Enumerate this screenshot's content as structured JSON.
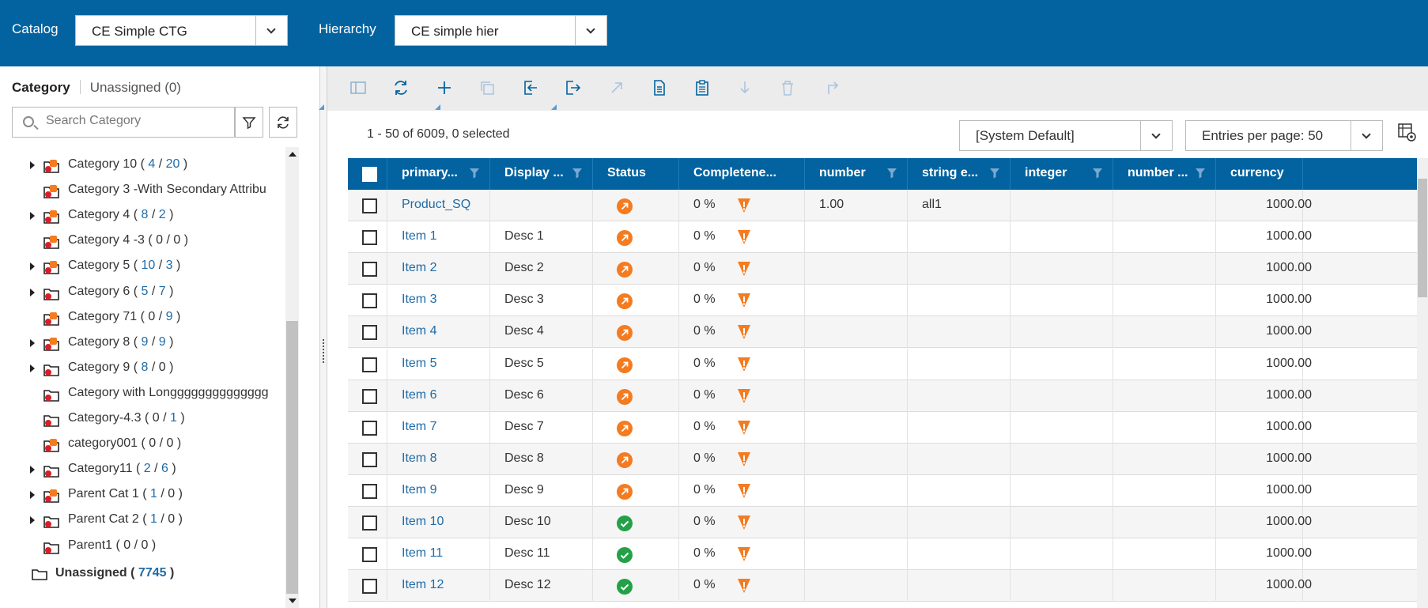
{
  "header": {
    "catalog_label": "Catalog",
    "catalog_value": "CE Simple CTG",
    "hierarchy_label": "Hierarchy",
    "hierarchy_value": "CE simple hier"
  },
  "left_panel": {
    "tab_category": "Category",
    "tab_unassigned": "Unassigned (0)",
    "search_placeholder": "Search Category",
    "tree": [
      {
        "name": "Category 10",
        "a": "4",
        "b": "20",
        "expandable": true,
        "badge": true
      },
      {
        "name": "Category 3 -With Secondary Attribu",
        "a": "",
        "b": "",
        "expandable": false,
        "badge": true
      },
      {
        "name": "Category 4",
        "a": "8",
        "b": "2",
        "expandable": true,
        "badge": true
      },
      {
        "name": "Category 4 -3",
        "a": "0",
        "b": "0",
        "expandable": false,
        "badge": true
      },
      {
        "name": "Category 5",
        "a": "10",
        "b": "3",
        "expandable": true,
        "badge": true
      },
      {
        "name": "Category 6",
        "a": "5",
        "b": "7",
        "expandable": true,
        "badge": false
      },
      {
        "name": "Category 71",
        "a": "0",
        "b": "9",
        "expandable": false,
        "badge": true
      },
      {
        "name": "Category 8",
        "a": "9",
        "b": "9",
        "expandable": true,
        "badge": true
      },
      {
        "name": "Category 9",
        "a": "8",
        "b": "0",
        "expandable": true,
        "badge": false
      },
      {
        "name": "Category with Longggggggggggggg",
        "a": "",
        "b": "",
        "expandable": false,
        "badge": false
      },
      {
        "name": "Category-4.3",
        "a": "0",
        "b": "1",
        "expandable": false,
        "badge": false
      },
      {
        "name": "category001",
        "a": "0",
        "b": "0",
        "expandable": false,
        "badge": true
      },
      {
        "name": "Category11",
        "a": "2",
        "b": "6",
        "expandable": true,
        "badge": false
      },
      {
        "name": "Parent Cat 1",
        "a": "1",
        "b": "0",
        "expandable": true,
        "badge": true
      },
      {
        "name": "Parent Cat 2",
        "a": "1",
        "b": "0",
        "expandable": true,
        "badge": false
      },
      {
        "name": "Parent1",
        "a": "0",
        "b": "0",
        "expandable": false,
        "badge": false
      }
    ],
    "unassigned_label": "Unassigned (",
    "unassigned_count": "7745",
    "unassigned_close": ")"
  },
  "main": {
    "summary": "1 - 50 of 6009, 0 selected",
    "view_select": "[System Default]",
    "entries_select": "Entries per page: 50",
    "toolbar_icons": [
      "panel-toggle-icon",
      "refresh-icon",
      "add-icon",
      "copy-icon",
      "import-icon",
      "export-icon",
      "open-external-icon",
      "document-icon",
      "clipboard-icon",
      "download-icon",
      "delete-icon",
      "redo-icon"
    ],
    "columns": [
      "primary...",
      "Display ...",
      "Status",
      "Completene...",
      "number",
      "string e...",
      "integer",
      "number ...",
      "currency"
    ],
    "rows": [
      {
        "primary": "Product_SQ",
        "display": "",
        "status": "orange",
        "complete": "0 %",
        "number": "1.00",
        "string": "all1",
        "integer": "",
        "number2": "",
        "currency": "1000.00"
      },
      {
        "primary": "Item 1",
        "display": "Desc 1",
        "status": "orange",
        "complete": "0 %",
        "number": "",
        "string": "",
        "integer": "",
        "number2": "",
        "currency": "1000.00"
      },
      {
        "primary": "Item 2",
        "display": "Desc 2",
        "status": "orange",
        "complete": "0 %",
        "number": "",
        "string": "",
        "integer": "",
        "number2": "",
        "currency": "1000.00"
      },
      {
        "primary": "Item 3",
        "display": "Desc 3",
        "status": "orange",
        "complete": "0 %",
        "number": "",
        "string": "",
        "integer": "",
        "number2": "",
        "currency": "1000.00"
      },
      {
        "primary": "Item 4",
        "display": "Desc 4",
        "status": "orange",
        "complete": "0 %",
        "number": "",
        "string": "",
        "integer": "",
        "number2": "",
        "currency": "1000.00"
      },
      {
        "primary": "Item 5",
        "display": "Desc 5",
        "status": "orange",
        "complete": "0 %",
        "number": "",
        "string": "",
        "integer": "",
        "number2": "",
        "currency": "1000.00"
      },
      {
        "primary": "Item 6",
        "display": "Desc 6",
        "status": "orange",
        "complete": "0 %",
        "number": "",
        "string": "",
        "integer": "",
        "number2": "",
        "currency": "1000.00"
      },
      {
        "primary": "Item 7",
        "display": "Desc 7",
        "status": "orange",
        "complete": "0 %",
        "number": "",
        "string": "",
        "integer": "",
        "number2": "",
        "currency": "1000.00"
      },
      {
        "primary": "Item 8",
        "display": "Desc 8",
        "status": "orange",
        "complete": "0 %",
        "number": "",
        "string": "",
        "integer": "",
        "number2": "",
        "currency": "1000.00"
      },
      {
        "primary": "Item 9",
        "display": "Desc 9",
        "status": "orange",
        "complete": "0 %",
        "number": "",
        "string": "",
        "integer": "",
        "number2": "",
        "currency": "1000.00"
      },
      {
        "primary": "Item 10",
        "display": "Desc 10",
        "status": "green",
        "complete": "0 %",
        "number": "",
        "string": "",
        "integer": "",
        "number2": "",
        "currency": "1000.00"
      },
      {
        "primary": "Item 11",
        "display": "Desc 11",
        "status": "green",
        "complete": "0 %",
        "number": "",
        "string": "",
        "integer": "",
        "number2": "",
        "currency": "1000.00"
      },
      {
        "primary": "Item 12",
        "display": "Desc 12",
        "status": "green",
        "complete": "0 %",
        "number": "",
        "string": "",
        "integer": "",
        "number2": "",
        "currency": "1000.00"
      }
    ]
  },
  "colors": {
    "brand": "#0263a0",
    "status_orange": "#f47b20",
    "status_green": "#24a148",
    "link": "#1f6ba6"
  }
}
